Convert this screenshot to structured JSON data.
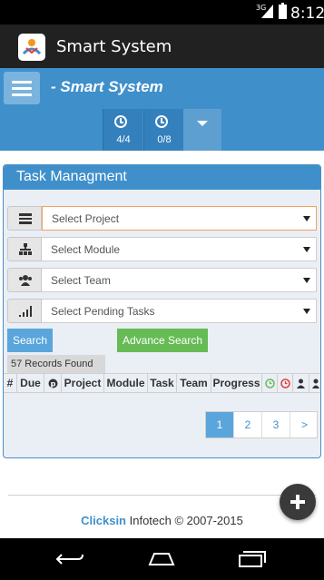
{
  "status_bar": {
    "network": "3G",
    "time": "8:12"
  },
  "action_bar": {
    "title": "Smart System"
  },
  "header": {
    "brand": "- Smart System"
  },
  "tabs": [
    {
      "count": "4/4"
    },
    {
      "count": "0/8"
    }
  ],
  "panel": {
    "title": "Task Managment",
    "selects": [
      {
        "placeholder": "Select Project",
        "icon": "list-icon"
      },
      {
        "placeholder": "Select Module",
        "icon": "sitemap-icon"
      },
      {
        "placeholder": "Select Team",
        "icon": "users-icon"
      },
      {
        "placeholder": "Select Pending Tasks",
        "icon": "signal-icon"
      }
    ],
    "search_label": "Search",
    "advance_search_label": "Advance Search",
    "records_found": "57 Records Found",
    "columns": [
      "#",
      "Due",
      "Project",
      "Module",
      "Task",
      "Team",
      "Progress"
    ],
    "pagination": [
      "1",
      "2",
      "3",
      ">"
    ]
  },
  "footer": {
    "brand": "Clicksin",
    "text": "Infotech © 2007-2015"
  },
  "colors": {
    "primary": "#3f8fcb",
    "success": "#66bb55",
    "danger": "#e53935"
  }
}
